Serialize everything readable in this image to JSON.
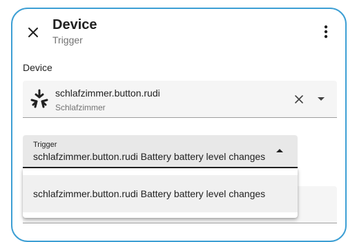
{
  "dialog": {
    "title": "Device",
    "subtitle": "Trigger",
    "close_icon": "close-icon",
    "more_icon": "more-vertical-icon"
  },
  "device_section": {
    "label": "Device",
    "selected_device": {
      "name": "schlafzimmer.button.rudi",
      "area": "Schlafzimmer",
      "icon": "device-brand-icon"
    },
    "clear_icon": "close-icon",
    "dropdown_icon": "chevron-down-icon"
  },
  "trigger_field": {
    "label": "Trigger",
    "value": "schlafzimmer.button.rudi Battery battery level changes",
    "state": "expanded",
    "arrow_icon": "arrow-up-icon"
  },
  "trigger_options": [
    "schlafzimmer.button.rudi Battery battery level changes"
  ],
  "colors": {
    "accent_border": "#3d9fd4",
    "text_primary": "#212121",
    "text_secondary": "#727272",
    "field_background": "#f5f5f5"
  }
}
